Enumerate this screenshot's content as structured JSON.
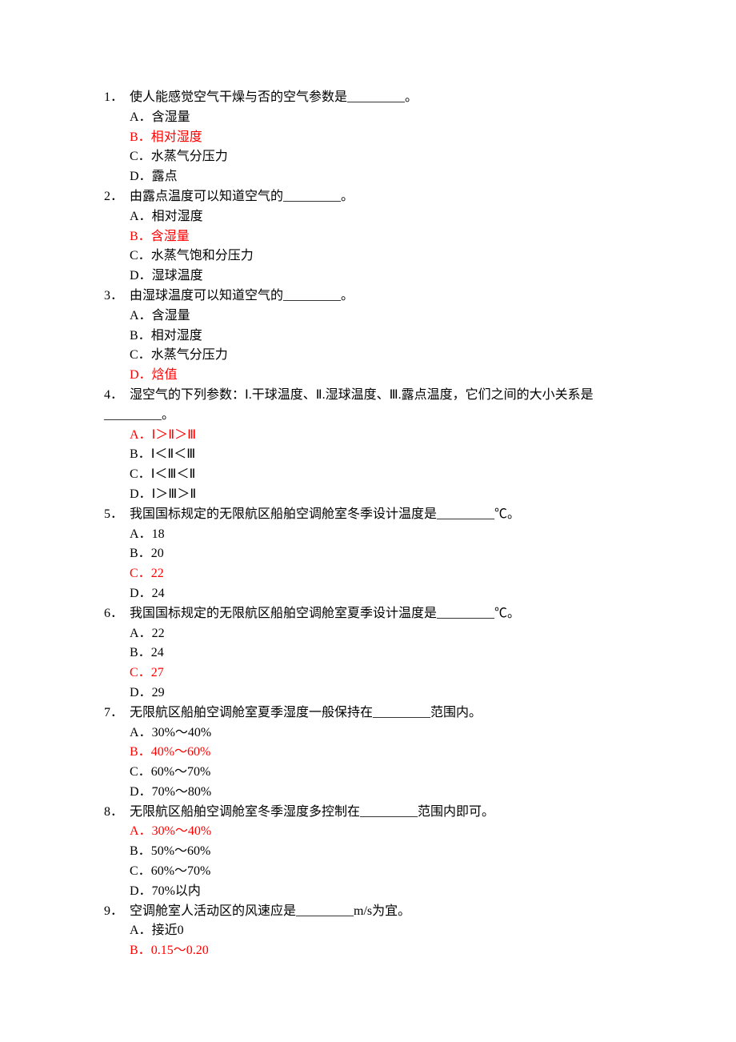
{
  "questions": [
    {
      "number": "1．",
      "stem": "使人能感觉空气干燥与否的空气参数是_________。",
      "options": [
        {
          "label": "A．",
          "text": "含湿量",
          "correct": false
        },
        {
          "label": "B．",
          "text": "相对湿度",
          "correct": true
        },
        {
          "label": "C．",
          "text": "水蒸气分压力",
          "correct": false
        },
        {
          "label": "D．",
          "text": "露点",
          "correct": false
        }
      ]
    },
    {
      "number": "2．",
      "stem": "由露点温度可以知道空气的_________。",
      "options": [
        {
          "label": "A．",
          "text": "相对湿度",
          "correct": false
        },
        {
          "label": "B．",
          "text": "含湿量",
          "correct": true
        },
        {
          "label": "C．",
          "text": "水蒸气饱和分压力",
          "correct": false
        },
        {
          "label": "D．",
          "text": "湿球温度",
          "correct": false
        }
      ]
    },
    {
      "number": "3．",
      "stem": "由湿球温度可以知道空气的_________。",
      "options": [
        {
          "label": "A．",
          "text": "含湿量",
          "correct": false
        },
        {
          "label": "B．",
          "text": "相对湿度",
          "correct": false
        },
        {
          "label": "C．",
          "text": "水蒸气分压力",
          "correct": false
        },
        {
          "label": "D．",
          "text": "焓值",
          "correct": true
        }
      ]
    },
    {
      "number": "4．",
      "stem": "湿空气的下列参数：Ⅰ.干球温度、Ⅱ.湿球温度、Ⅲ.露点温度，它们之间的大小关系是_________。",
      "options": [
        {
          "label": "A．",
          "text": "Ⅰ＞Ⅱ＞Ⅲ",
          "correct": true
        },
        {
          "label": "B．",
          "text": "Ⅰ＜Ⅱ＜Ⅲ",
          "correct": false
        },
        {
          "label": "C．",
          "text": "Ⅰ＜Ⅲ＜Ⅱ",
          "correct": false
        },
        {
          "label": "D．",
          "text": "Ⅰ＞Ⅲ＞Ⅱ",
          "correct": false
        }
      ]
    },
    {
      "number": "5．",
      "stem": "我国国标规定的无限航区船舶空调舱室冬季设计温度是_________℃。",
      "options": [
        {
          "label": "A．",
          "text": "18",
          "correct": false
        },
        {
          "label": "B．",
          "text": "20",
          "correct": false
        },
        {
          "label": "C．",
          "text": "22",
          "correct": true
        },
        {
          "label": "D．",
          "text": "24",
          "correct": false
        }
      ]
    },
    {
      "number": "6．",
      "stem": "我国国标规定的无限航区船舶空调舱室夏季设计温度是_________℃。",
      "options": [
        {
          "label": "A．",
          "text": "22",
          "correct": false
        },
        {
          "label": "B．",
          "text": "24",
          "correct": false
        },
        {
          "label": "C．",
          "text": "27",
          "correct": true
        },
        {
          "label": "D．",
          "text": "29",
          "correct": false
        }
      ]
    },
    {
      "number": "7．",
      "stem": "无限航区船舶空调舱室夏季湿度一般保持在_________范围内。",
      "options": [
        {
          "label": "A．",
          "text": "30%～40%",
          "correct": false
        },
        {
          "label": "B．",
          "text": "40%～60%",
          "correct": true
        },
        {
          "label": "C．",
          "text": "60%～70%",
          "correct": false
        },
        {
          "label": "D．",
          "text": "70%～80%",
          "correct": false
        }
      ]
    },
    {
      "number": "8．",
      "stem": "无限航区船舶空调舱室冬季湿度多控制在_________范围内即可。",
      "options": [
        {
          "label": "A．",
          "text": "30%～40%",
          "correct": true
        },
        {
          "label": "B．",
          "text": "50%～60%",
          "correct": false
        },
        {
          "label": "C．",
          "text": "60%～70%",
          "correct": false
        },
        {
          "label": "D．",
          "text": "70%以内",
          "correct": false
        }
      ]
    },
    {
      "number": "9．",
      "stem": "空调舱室人活动区的风速应是_________m/s为宜。",
      "options": [
        {
          "label": "A．",
          "text": "接近0",
          "correct": false
        },
        {
          "label": "B．",
          "text": "0.15～0.20",
          "correct": true
        }
      ]
    }
  ]
}
